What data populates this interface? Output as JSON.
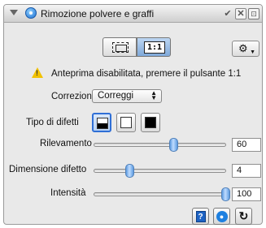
{
  "panel": {
    "title": "Rimozione polvere e graffi",
    "title_icon": "dust-removal-icon",
    "header_buttons": [
      "check-icon",
      "close-icon",
      "detach-icon"
    ]
  },
  "preview_modes": [
    {
      "icon": "frame-preview-icon",
      "selected": false
    },
    {
      "icon": "ratio-1-1-icon",
      "label": "1:1",
      "selected": true
    }
  ],
  "options_button": {
    "icon": "gear-icon"
  },
  "warning": {
    "icon": "warning-icon",
    "text": "Anteprima disabilitata, premere il pulsante 1:1"
  },
  "correction": {
    "label": "Correzione",
    "value": "Correggi"
  },
  "defect_type": {
    "label": "Tipo di difetti",
    "options": [
      {
        "icon": "defect-dark-icon",
        "selected": true
      },
      {
        "icon": "defect-light-icon",
        "selected": false
      },
      {
        "icon": "defect-black-icon",
        "selected": false
      }
    ]
  },
  "sliders": [
    {
      "label": "Rilevamento",
      "value": "60",
      "level": 60
    },
    {
      "label": "Dimensione difetto",
      "value": "4",
      "level": 27
    },
    {
      "label": "Intensità",
      "value": "100",
      "level": 100
    }
  ],
  "footer_buttons": [
    "help-icon",
    "preview-icon",
    "reset-icon"
  ],
  "colors": {
    "accent": "#2f6fd6",
    "warning": "#f2c200",
    "panel": "#e9e9e9"
  }
}
